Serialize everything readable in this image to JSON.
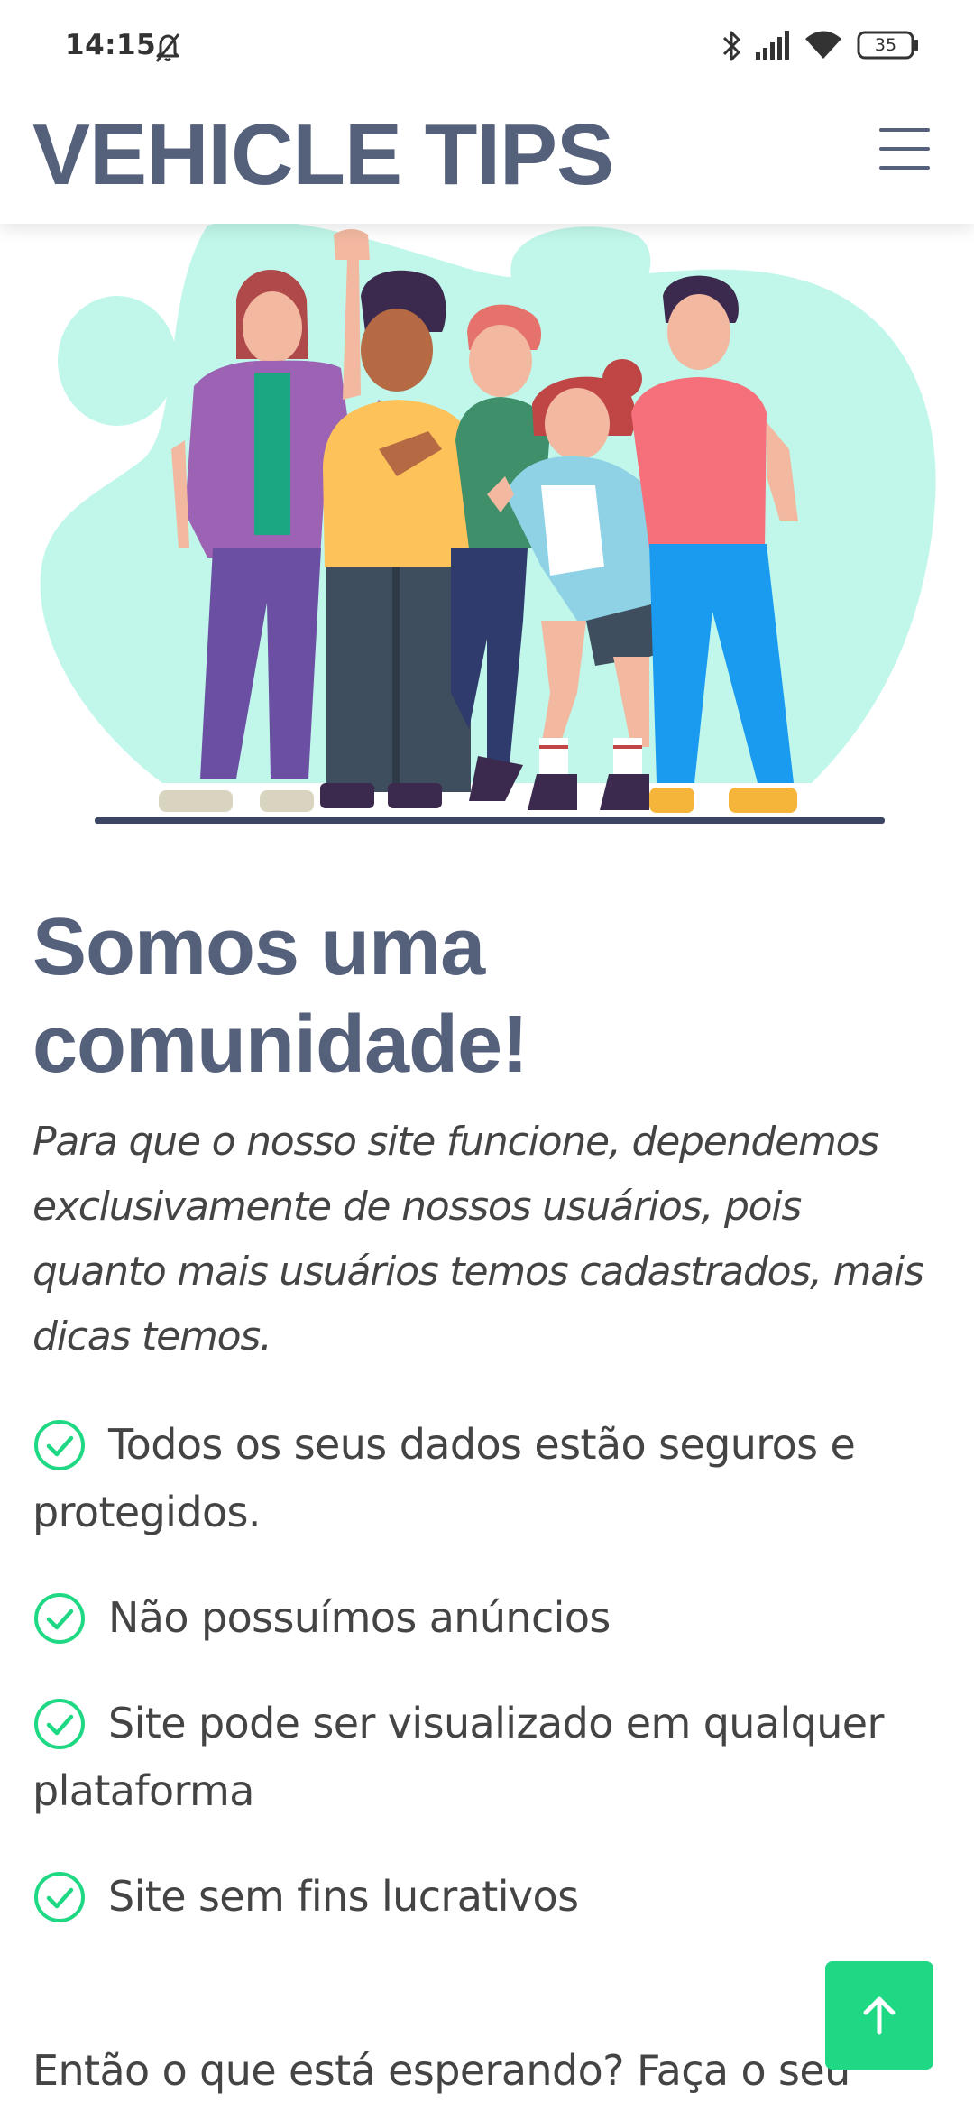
{
  "status_bar": {
    "time": "14:15",
    "battery": "35",
    "icons": [
      "mute-icon",
      "bluetooth-icon",
      "signal-icon",
      "wifi-icon",
      "battery-icon"
    ]
  },
  "header": {
    "brand": "VEHICLE TIPS",
    "menu_icon": "hamburger-menu-icon"
  },
  "hero": {
    "image": "group-of-friends-illustration"
  },
  "main": {
    "title": "Somos uma comunidade!",
    "lead": "Para que o nosso site funcione, dependemos exclusivamente de nossos usuários, pois quanto mais usuários temos cadastrados, mais dicas temos.",
    "features": [
      {
        "icon": "check-circle-icon",
        "text": "Todos os seus dados estão seguros e protegidos."
      },
      {
        "icon": "check-circle-icon",
        "text": "Não possuímos anúncios"
      },
      {
        "icon": "check-circle-icon",
        "text": "Site pode ser visualizado em qualquer plataforma"
      },
      {
        "icon": "check-circle-icon",
        "text": "Site sem fins lucrativos"
      }
    ],
    "cta_text": "Então o que está esperando? Faça o seu"
  },
  "back_to_top": {
    "icon": "arrow-up-icon"
  },
  "colors": {
    "brand": "#55607a",
    "accent": "#1ed883",
    "text": "#444444",
    "hero_blob": "#c0f7ea"
  }
}
